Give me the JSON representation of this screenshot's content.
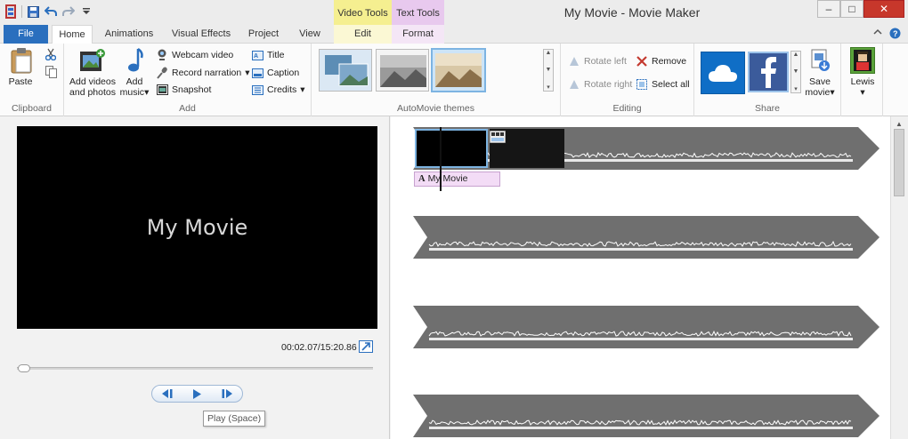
{
  "window": {
    "title": "My Movie - Movie Maker",
    "context_tabs": {
      "video_tools": "Video Tools",
      "text_tools": "Text Tools"
    },
    "controls": {
      "minimize": "–",
      "maximize": "□",
      "close": "✕"
    }
  },
  "tabs": {
    "file": "File",
    "home": "Home",
    "animations": "Animations",
    "visual_effects": "Visual Effects",
    "project": "Project",
    "view": "View",
    "edit": "Edit",
    "format": "Format"
  },
  "ribbon": {
    "clipboard": {
      "label": "Clipboard",
      "paste": "Paste"
    },
    "add": {
      "label": "Add",
      "add_videos_line1": "Add videos",
      "add_videos_line2": "and photos",
      "add_music": "Add",
      "add_music_line2": "music",
      "webcam_video": "Webcam video",
      "record_narration": "Record narration",
      "snapshot": "Snapshot",
      "title": "Title",
      "caption": "Caption",
      "credits": "Credits"
    },
    "automovie": {
      "label": "AutoMovie themes"
    },
    "editing": {
      "label": "Editing",
      "rotate_left": "Rotate left",
      "rotate_right": "Rotate right",
      "remove": "Remove",
      "select_all": "Select all"
    },
    "share": {
      "label": "Share",
      "save_movie": "Save",
      "save_movie_line2": "movie"
    },
    "user": {
      "name": "Lewis"
    }
  },
  "preview": {
    "title_text": "My Movie",
    "timecode": "00:02.07/15:20.86",
    "playback_position": 0.002,
    "tooltip": "Play (Space)"
  },
  "storyboard": {
    "caption_item": "My Movie"
  },
  "colors": {
    "file_tab": "#2a6fbe",
    "video_tools": "#f5ef90",
    "text_tools": "#e8c9ee",
    "close_button": "#c7372b",
    "track_fill": "#6f6f6f"
  }
}
